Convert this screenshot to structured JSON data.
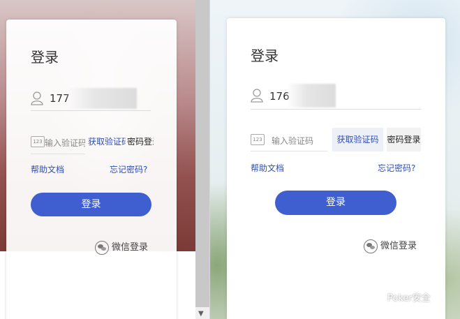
{
  "left": {
    "title": "登录",
    "phone": "177",
    "code_placeholder": "输入验证码",
    "get_code": "获取验证码",
    "pwd_login": "密码登录",
    "help": "帮助文档",
    "forgot": "忘记密码?",
    "login_button": "登录",
    "wechat": "微信登录",
    "code_icon_text": "123"
  },
  "right": {
    "title": "登录",
    "phone": "176",
    "code_placeholder": "输入验证码",
    "get_code": "获取验证码",
    "pwd_login": "密码登录",
    "help": "帮助文档",
    "forgot": "忘记密码?",
    "login_button": "登录",
    "wechat": "微信登录",
    "code_icon_text": "123"
  },
  "watermark": "Poker安全",
  "colors": {
    "primary": "#3f5fd0",
    "link": "#2f4fb5"
  }
}
